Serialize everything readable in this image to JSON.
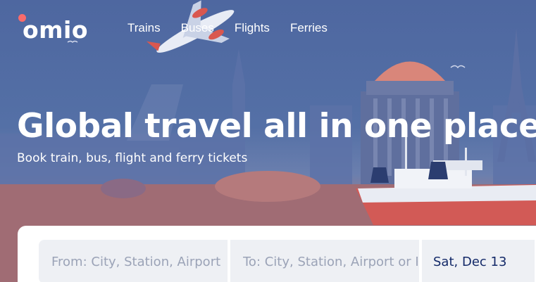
{
  "brand": {
    "name": "omio",
    "accent": "#fa6b6b"
  },
  "nav": {
    "items": [
      {
        "label": "Trains"
      },
      {
        "label": "Buses"
      },
      {
        "label": "Flights"
      },
      {
        "label": "Ferries"
      }
    ]
  },
  "hero": {
    "title": "Global travel all in one place",
    "subtitle": "Book train, bus, flight and ferry tickets"
  },
  "search": {
    "from_placeholder": "From: City, Station, Airport",
    "to_placeholder": "To: City, Station, Airport or Port",
    "date_value": "Sat, Dec 13"
  },
  "colors": {
    "hero_bg": "#4e67a0",
    "text_dark": "#132968",
    "field_bg": "#eef0f4"
  }
}
